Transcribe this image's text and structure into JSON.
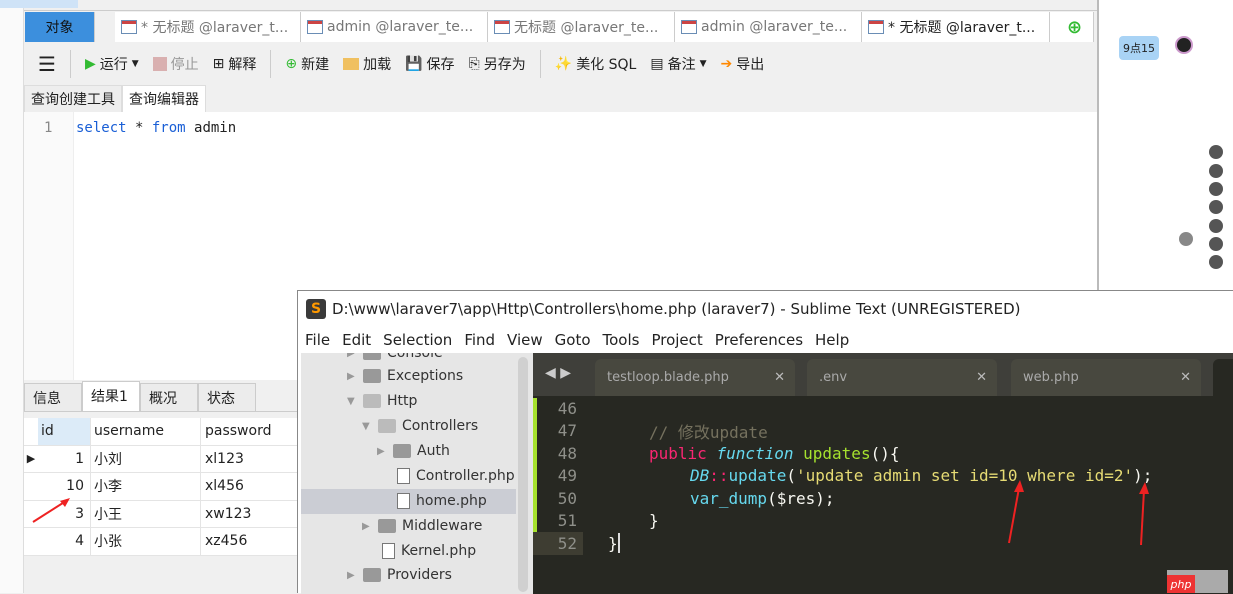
{
  "navicat": {
    "tabs": [
      {
        "label": "对象"
      },
      {
        "label": "* 无标题 @laraver_t..."
      },
      {
        "label": "admin @laraver_te..."
      },
      {
        "label": "无标题 @laraver_te..."
      },
      {
        "label": "admin @laraver_te..."
      },
      {
        "label": "* 无标题 @laraver_t..."
      }
    ],
    "toolbar": {
      "run": "运行",
      "stop": "停止",
      "explain": "解释",
      "new": "新建",
      "load": "加载",
      "save": "保存",
      "save_as": "另存为",
      "beautify": "美化 SQL",
      "comment": "备注",
      "export": "导出"
    },
    "subtabs": [
      "查询创建工具",
      "查询编辑器"
    ],
    "editor": {
      "line": "1",
      "kw1": "select",
      "mid": " * ",
      "kw2": "from",
      "rest": " admin"
    },
    "result_tabs": [
      "信息",
      "结果1",
      "概况",
      "状态"
    ],
    "columns": [
      "id",
      "username",
      "password"
    ],
    "rows": [
      [
        "1",
        "小刘",
        "xl123"
      ],
      [
        "10",
        "小李",
        "xl456"
      ],
      [
        "3",
        "小王",
        "xw123"
      ],
      [
        "4",
        "小张",
        "xz456"
      ]
    ]
  },
  "chat": {
    "bubble": "9点15"
  },
  "sublime": {
    "title": "D:\\www\\laraver7\\app\\Http\\Controllers\\home.php (laraver7) - Sublime Text (UNREGISTERED)",
    "menu": [
      "File",
      "Edit",
      "Selection",
      "Find",
      "View",
      "Goto",
      "Tools",
      "Project",
      "Preferences",
      "Help"
    ],
    "tree": [
      "Console",
      "Exceptions",
      "Http",
      "Controllers",
      "Auth",
      "Controller.php",
      "home.php",
      "Middleware",
      "Kernel.php",
      "Providers"
    ],
    "tabs": [
      "testloop.blade.php",
      ".env",
      "web.php"
    ],
    "code": {
      "lines": [
        "46",
        "47",
        "48",
        "49",
        "50",
        "51",
        "52"
      ],
      "l47": "// 修改update",
      "l48a": "public",
      "l48b": "function",
      "l48c": "updates",
      "l48d": "(){",
      "l49a": "DB",
      "l49b": "::",
      "l49c": "update",
      "l49d": "(",
      "l49e": "'update admin set id=10 where id=2'",
      "l49f": ");",
      "l50a": "var_dump",
      "l50b": "($res);",
      "l51": "}",
      "l52": "}"
    }
  },
  "watermark": "php"
}
